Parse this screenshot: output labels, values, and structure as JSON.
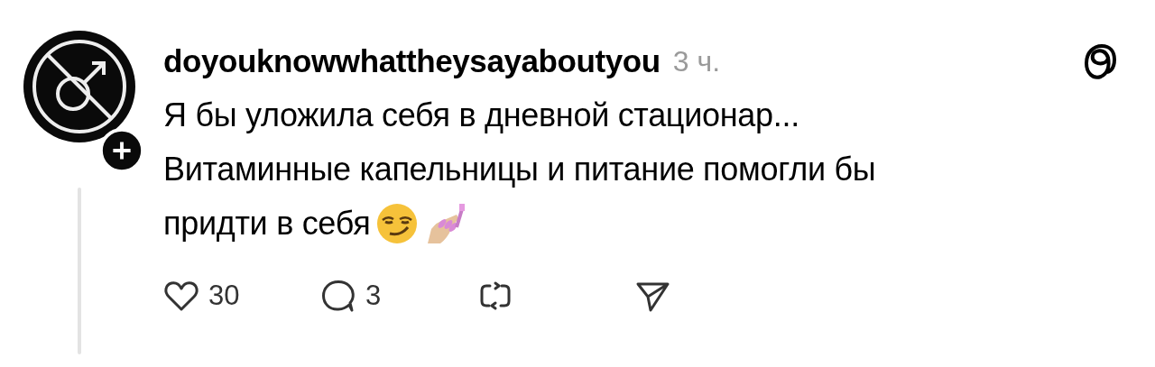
{
  "post": {
    "username": "doyouknowwhattheysayaboutyou",
    "time": "3 ч.",
    "text_lines": [
      "Я бы уложила себя в дневной стационар...",
      "Витаминные капельницы и питание помогли бы",
      "придти в себя"
    ],
    "actions": [
      {
        "kind": "like",
        "count": "30"
      },
      {
        "kind": "reply",
        "count": "3"
      },
      {
        "kind": "repost"
      },
      {
        "kind": "share"
      }
    ]
  }
}
